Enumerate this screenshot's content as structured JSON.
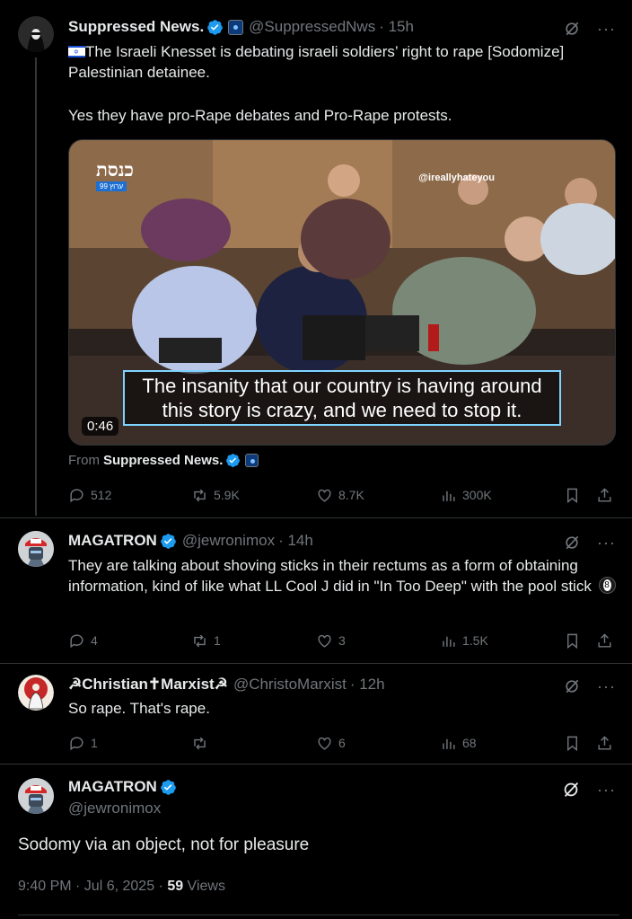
{
  "post1": {
    "name": "Suppressed News.",
    "handle": "@SuppressedNws",
    "time": "· 15h",
    "text1": "The Israeli Knesset is debating israeli soldiers’ right to rape [Sodomize] Palestinian detainee.",
    "text2": "Yes they have pro-Rape debates and Pro-Rape protests.",
    "flag_icon": "israel-flag-icon",
    "video": {
      "caption_line1": "The insanity that our country is having around",
      "caption_line2": "this story is crazy, and we need to stop it.",
      "duration": "0:46",
      "watermark": "@ireallyhateyou",
      "logo_text": "כנסת",
      "logo_sub": "ערוץ 99"
    },
    "from_label": "From",
    "from_name": "Suppressed News.",
    "replies": "512",
    "reposts": "5.9K",
    "likes": "8.7K",
    "views": "300K"
  },
  "post2": {
    "name": "MAGATRON",
    "handle": "@jewronimox",
    "time": "· 14h",
    "text": "They are talking about shoving sticks in their rectums as a form of obtaining information, kind of like what LL Cool J did in \"In Too Deep\" with the pool stick",
    "emoji": "8",
    "replies": "4",
    "reposts": "1",
    "likes": "3",
    "views": "1.5K"
  },
  "post3": {
    "name": "☭Christian✝Marxist☭",
    "handle": "@ChristoMarxist",
    "time": "· 12h",
    "text": "So rape. That's rape.",
    "replies": "1",
    "reposts": "",
    "likes": "6",
    "views": "68"
  },
  "post4": {
    "name": "MAGATRON",
    "handle": "@jewronimox",
    "text": "Sodomy via an object, not for pleasure",
    "timestamp": "9:40 PM · Jul 6, 2025 · ",
    "views_count": "59",
    "views_label": " Views"
  },
  "colors": {
    "background": "#000000",
    "text": "#e7e9ea",
    "muted": "#71767b",
    "verified": "#1d9bf0",
    "divider": "#2f3336"
  }
}
